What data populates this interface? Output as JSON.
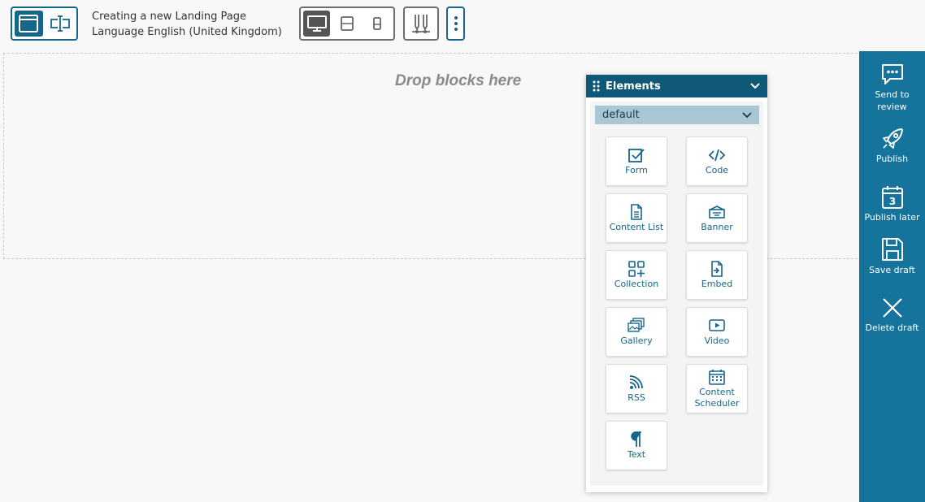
{
  "toolbar": {
    "mode_buttons": [
      {
        "icon": "browser-window-icon",
        "active": true
      },
      {
        "icon": "text-field-icon",
        "active": false
      }
    ],
    "page_title": "Creating a new Landing Page",
    "page_language": "Language English (United Kingdom)",
    "device_buttons": [
      {
        "icon": "desktop-icon",
        "active": true
      },
      {
        "icon": "tablet-icon",
        "active": false
      },
      {
        "icon": "mobile-icon",
        "active": false
      }
    ],
    "compare_icon": "compare-icon",
    "more_icon": "vertical-dots-icon"
  },
  "canvas": {
    "drop_placeholder": "Drop blocks here"
  },
  "elements_panel": {
    "title": "Elements",
    "filter_value": "default",
    "items": [
      {
        "label": "Form",
        "icon": "form-icon"
      },
      {
        "label": "Code",
        "icon": "code-icon"
      },
      {
        "label": "Content List",
        "icon": "content-list-icon"
      },
      {
        "label": "Banner",
        "icon": "banner-icon"
      },
      {
        "label": "Collection",
        "icon": "collection-icon"
      },
      {
        "label": "Embed",
        "icon": "embed-icon"
      },
      {
        "label": "Gallery",
        "icon": "gallery-icon"
      },
      {
        "label": "Video",
        "icon": "video-icon"
      },
      {
        "label": "RSS",
        "icon": "rss-icon"
      },
      {
        "label": "Content\nScheduler",
        "icon": "calendar-icon"
      },
      {
        "label": "Text",
        "icon": "pilcrow-icon"
      }
    ]
  },
  "actions": {
    "send_to_review": "Send to review",
    "publish": "Publish",
    "publish_later": "Publish later",
    "publish_later_day": "3",
    "save_draft": "Save draft",
    "delete_draft": "Delete draft"
  },
  "colors": {
    "accent": "#16668c",
    "panel_header": "#0f5878",
    "action_bar": "#16739c",
    "filter_bg": "#a9c6d4"
  }
}
